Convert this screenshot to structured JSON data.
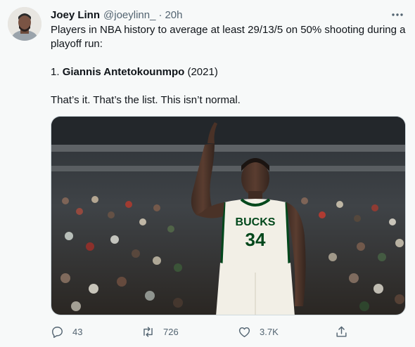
{
  "tweet": {
    "author_name": "Joey Linn",
    "author_handle": "@joeylinn_",
    "separator": "·",
    "time": "20h",
    "line1": "Players in NBA history to average at least 29/13/5 on 50% shooting during a playoff run:",
    "list_prefix": "1. ",
    "list_name": "Giannis Antetokounmpo",
    "list_suffix": " (2021)",
    "line3": "That’s it. That’s the list. This isn’t normal.",
    "media": {
      "jersey_team": "BUCKS",
      "jersey_number": "34"
    }
  },
  "actions": {
    "reply_count": "43",
    "retweet_count": "726",
    "like_count": "3.7K"
  },
  "colors": {
    "text": "#0f1419",
    "secondary": "#536471",
    "background": "#f7f9f9",
    "jersey": "#f2efe6",
    "jersey_trim": "#00471b"
  },
  "icons": [
    "more-icon",
    "reply-icon",
    "retweet-icon",
    "like-icon",
    "share-icon"
  ]
}
